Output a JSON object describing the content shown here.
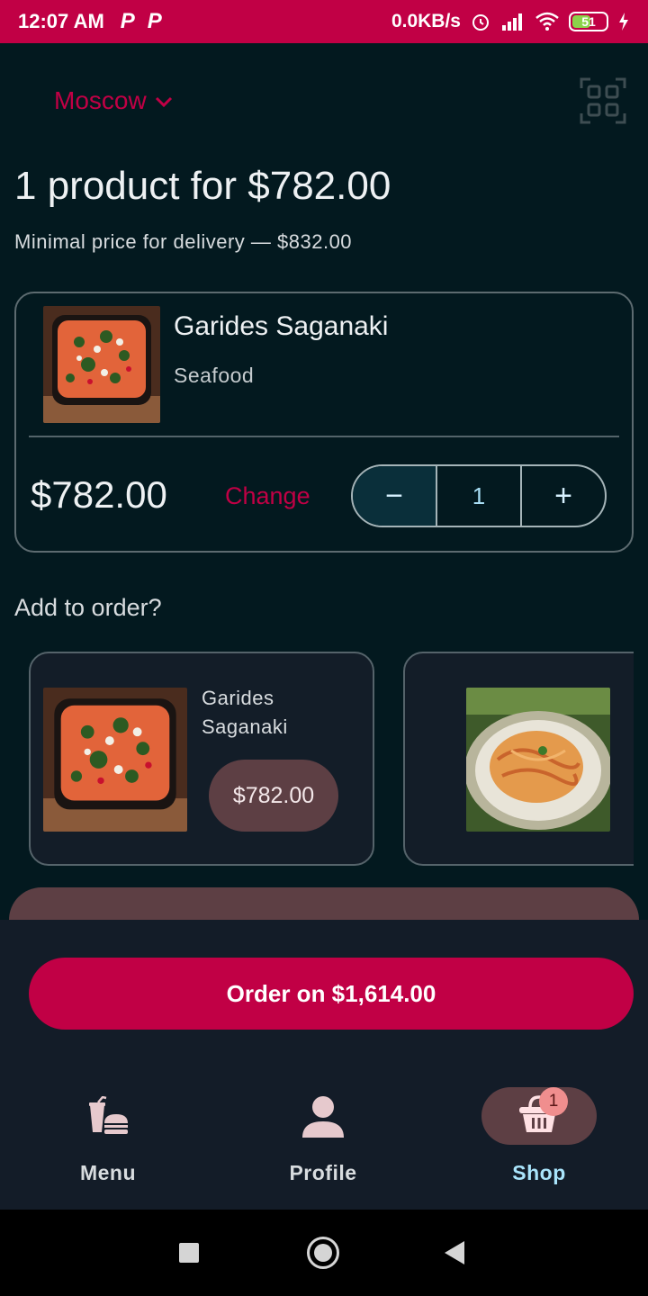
{
  "status_bar": {
    "time": "12:07 AM",
    "badges": [
      "P",
      "P"
    ],
    "net_speed": "0.0KB/s",
    "battery": "51"
  },
  "header": {
    "city": "Moscow",
    "qr_icon": "qr-scan-icon"
  },
  "summary": {
    "title": "1 product for $782.00",
    "subtitle": "Minimal price for delivery — $832.00"
  },
  "cart_item": {
    "name": "Garides Saganaki",
    "category": "Seafood",
    "price": "$782.00",
    "change_label": "Change",
    "quantity": "1",
    "minus_label": "−",
    "plus_label": "+"
  },
  "add_to_order": {
    "title": "Add to order?",
    "items": [
      {
        "name": "Garides Saganaki",
        "price": "$782.00"
      }
    ]
  },
  "order_button": {
    "label": "Order on $1,614.00"
  },
  "bottom_nav": {
    "items": [
      {
        "label": "Menu",
        "icon": "food-drink-icon"
      },
      {
        "label": "Profile",
        "icon": "person-icon"
      },
      {
        "label": "Shop",
        "icon": "basket-icon",
        "badge": "1"
      }
    ]
  },
  "colors": {
    "accent": "#c10045",
    "background": "#03191f",
    "panel": "#131c28",
    "chip": "#5d3f44"
  }
}
